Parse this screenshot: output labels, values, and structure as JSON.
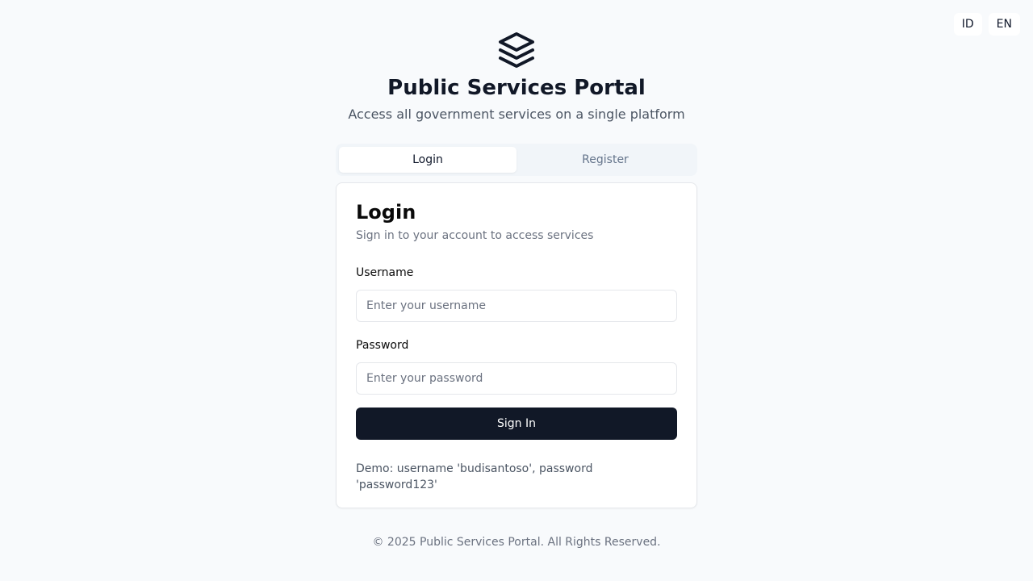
{
  "language_switch": {
    "options": [
      "ID",
      "EN"
    ]
  },
  "header": {
    "logo_icon": "layers-icon",
    "title": "Public Services Portal",
    "subtitle": "Access all government services on a single platform"
  },
  "tabs": [
    {
      "label": "Login",
      "active": true
    },
    {
      "label": "Register",
      "active": false
    }
  ],
  "login_card": {
    "title": "Login",
    "description": "Sign in to your account to access services",
    "username": {
      "label": "Username",
      "placeholder": "Enter your username",
      "value": ""
    },
    "password": {
      "label": "Password",
      "placeholder": "Enter your password",
      "value": ""
    },
    "submit_label": "Sign In",
    "demo_note": "Demo: username 'budisantoso', password 'password123'"
  },
  "footer": {
    "text": "© 2025 Public Services Portal. All Rights Reserved."
  },
  "colors": {
    "primary_button": "#111827",
    "background": "#f8fafc"
  }
}
